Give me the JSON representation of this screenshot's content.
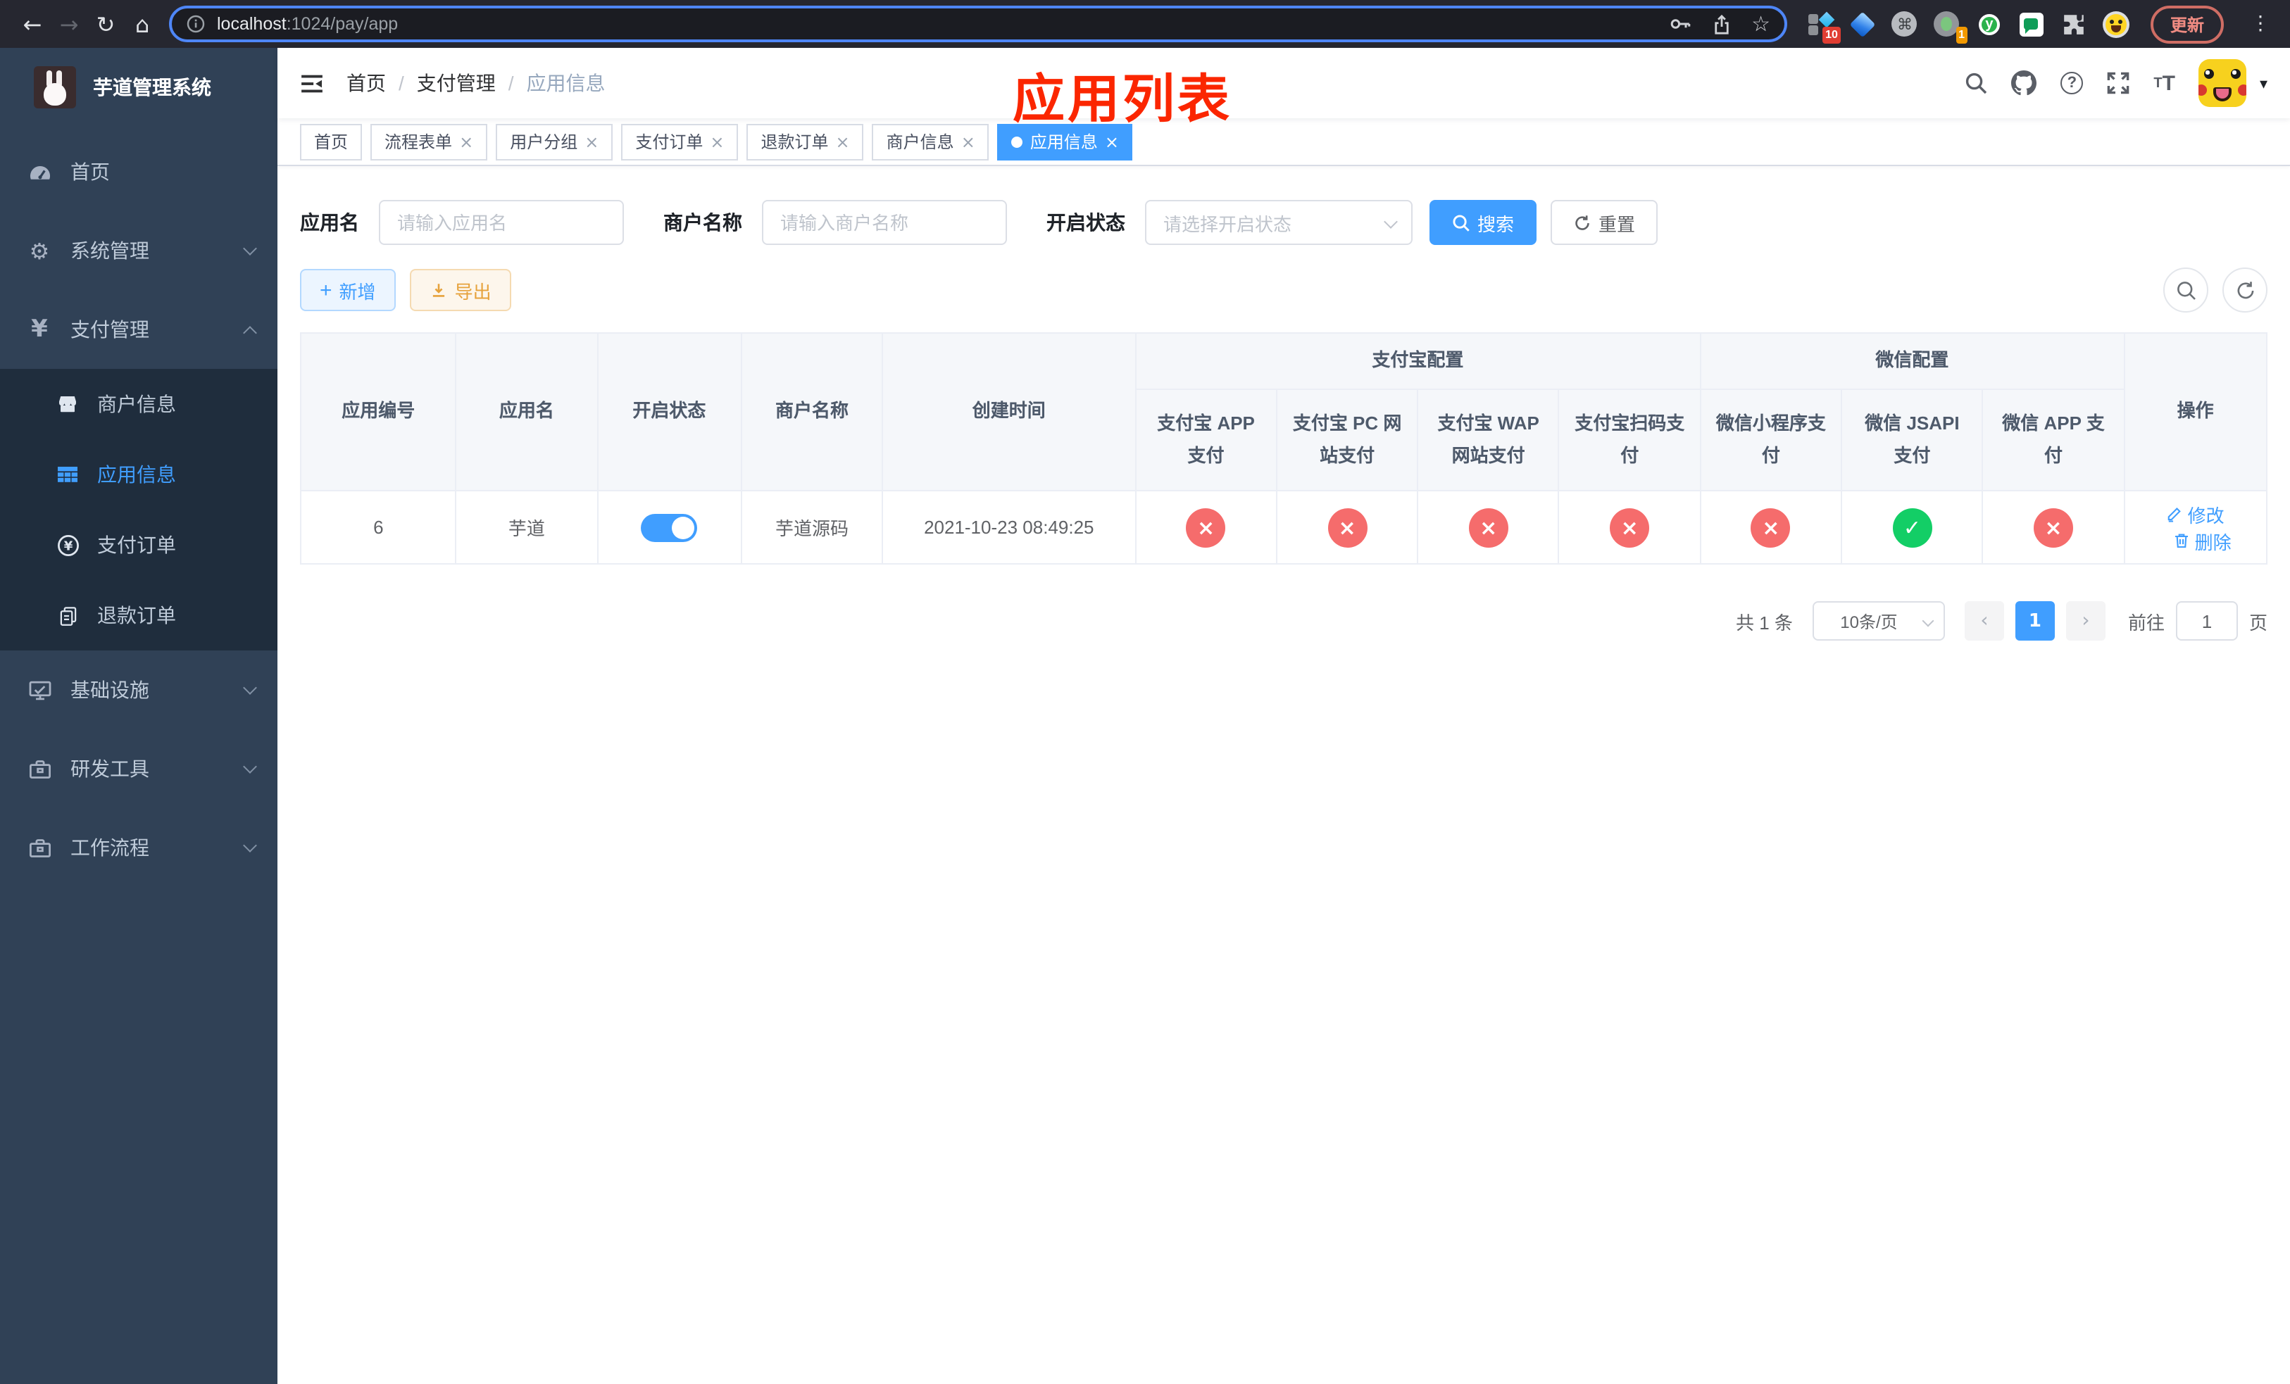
{
  "browser": {
    "url_host": "localhost",
    "url_path": ":1024/pay/app",
    "update_label": "更新",
    "ext_badge_red": "10",
    "ext_badge_orange": "1",
    "ext_y_letter": "y"
  },
  "icons": {
    "back": "←",
    "forward": "→",
    "reload": "↻",
    "home": "⌂",
    "star": "☆",
    "command": "⌘",
    "kebab": "⋮",
    "caret_down": "▾",
    "question": "?",
    "close": "×",
    "plus": "+",
    "yen": "¥",
    "fail": "×",
    "success": "✓",
    "page_prev": "‹",
    "page_next": "›",
    "font_size_small": "T",
    "font_size_large": "T"
  },
  "sidebar": {
    "title": "芋道管理系统",
    "items": [
      {
        "label": "首页",
        "icon": "dashboard-icon"
      },
      {
        "label": "系统管理",
        "icon": "gear-icon"
      },
      {
        "label": "支付管理",
        "icon": "yen-icon",
        "children": [
          {
            "label": "商户信息",
            "icon": "shop-icon"
          },
          {
            "label": "应用信息",
            "icon": "grid-icon"
          },
          {
            "label": "支付订单",
            "icon": "yen-circle-icon"
          },
          {
            "label": "退款订单",
            "icon": "document-icon"
          }
        ]
      },
      {
        "label": "基础设施",
        "icon": "monitor-icon"
      },
      {
        "label": "研发工具",
        "icon": "toolbox-icon"
      },
      {
        "label": "工作流程",
        "icon": "toolbox-icon"
      }
    ]
  },
  "header": {
    "breadcrumb": [
      "首页",
      "支付管理",
      "应用信息"
    ],
    "annotation": "应用列表"
  },
  "tabs": [
    {
      "label": "首页"
    },
    {
      "label": "流程表单"
    },
    {
      "label": "用户分组"
    },
    {
      "label": "支付订单"
    },
    {
      "label": "退款订单"
    },
    {
      "label": "商户信息"
    },
    {
      "label": "应用信息"
    }
  ],
  "filters": {
    "app_name_label": "应用名",
    "app_name_placeholder": "请输入应用名",
    "merchant_label": "商户名称",
    "merchant_placeholder": "请输入商户名称",
    "status_label": "开启状态",
    "status_placeholder": "请选择开启状态",
    "search_label": "搜索",
    "reset_label": "重置"
  },
  "toolbar": {
    "add_label": "新增",
    "export_label": "导出"
  },
  "table": {
    "columns": {
      "id": "应用编号",
      "name": "应用名",
      "status": "开启状态",
      "merchant": "商户名称",
      "created": "创建时间",
      "actions": "操作"
    },
    "groups": {
      "alipay": "支付宝配置",
      "wechat": "微信配置"
    },
    "sub_columns": [
      "支付宝 APP 支付",
      "支付宝 PC 网站支付",
      "支付宝 WAP 网站支付",
      "支付宝扫码支付",
      "微信小程序支付",
      "微信 JSAPI 支付",
      "微信 APP 支付"
    ],
    "row": {
      "id": "6",
      "name": "芋道",
      "status_on": true,
      "merchant": "芋道源码",
      "created": "2021-10-23 08:49:25",
      "payment_statuses": [
        "fail",
        "fail",
        "fail",
        "fail",
        "fail",
        "success",
        "fail"
      ],
      "edit_label": "修改",
      "delete_label": "删除"
    }
  },
  "pagination": {
    "total_label": "共 1 条",
    "page_size_label": "10条/页",
    "current_page": "1",
    "goto_label": "前往",
    "goto_value": "1",
    "page_unit": "页"
  }
}
